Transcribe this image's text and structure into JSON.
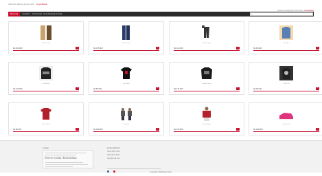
{
  "topbar": {
    "welcome": "Selamat datang di toko kami,",
    "login_link": "Login/Daftar",
    "greeting": "Selamat datang di toko kami,",
    "greeting_link": "Keranjang"
  },
  "nav": {
    "items": [
      "Beranda",
      "Jual Beli",
      "Konfirmasi",
      "Cara Belanja",
      "Kontak"
    ]
  },
  "search": {
    "placeholder": ""
  },
  "products": [
    {
      "name": "Celana Chino",
      "price": "Rp 150.000",
      "img": "pants-beige"
    },
    {
      "name": "Celana Jeans",
      "price": "Rp 175.000",
      "img": "jeans-blue"
    },
    {
      "name": "Celana Jogger",
      "price": "Rp 120.000",
      "img": "jogger-dark"
    },
    {
      "name": "Kaos Biru",
      "price": "Rp 95.000",
      "img": "tshirt-blue"
    },
    {
      "name": "Jaket Hitam",
      "price": "Rp 210.000",
      "img": "jacket-black"
    },
    {
      "name": "Kaos Band",
      "price": "Rp 85.000",
      "img": "tshirt-black"
    },
    {
      "name": "Sweater Hitam",
      "price": "Rp 175.000",
      "img": "sweater-black"
    },
    {
      "name": "Kaos Print",
      "price": "Rp 90.000",
      "img": "tshirt-print"
    },
    {
      "name": "Kaos Merah",
      "price": "Rp 80.000",
      "img": "tshirt-red"
    },
    {
      "name": "Kaos Set",
      "price": "Rp 150.000",
      "img": "tshirt-pair"
    },
    {
      "name": "Kemeja Merah",
      "price": "Rp 130.000",
      "img": "shirt-red"
    },
    {
      "name": "Sepatu Pink",
      "price": "Rp 250.000",
      "img": "shoes-pink"
    }
  ],
  "footer": {
    "map_title": "Lokasi",
    "map_error": "Server tidak ditemukan",
    "contact_title": "Hubungi Kami",
    "contact_lines": [
      "0812-3456-7890",
      "0813-9876-5432",
      "toko@email.com"
    ],
    "copyright": "Copyright © 2024 Toko Online"
  },
  "colors": {
    "accent": "#c8102e",
    "nav_bg": "#2b2b2b"
  }
}
